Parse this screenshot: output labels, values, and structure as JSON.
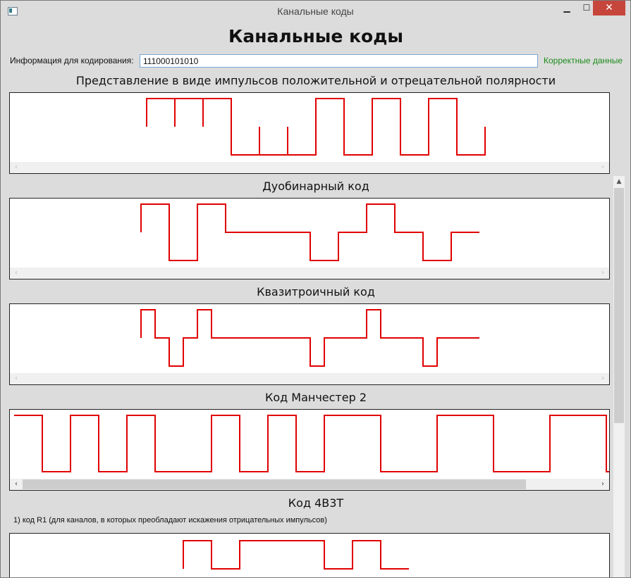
{
  "window": {
    "title": "Канальные коды"
  },
  "header": {
    "title": "Канальные коды",
    "input_label": "Информация для кодирования:",
    "input_value": "111000101010",
    "status": "Корректные данные",
    "status_color": "#1a8a1a"
  },
  "signal_color": "#e00000",
  "sections": {
    "polar": {
      "title": "Представление в виде импульсов положительной и отрецательной полярности"
    },
    "duobinary": {
      "title": "Дуобинарный код"
    },
    "quasi": {
      "title": "Квазитроичный код"
    },
    "manchester": {
      "title": "Код Манчестер 2"
    },
    "c4b3t": {
      "title": "Код 4B3T",
      "description": "1) код R1 (для каналов, в которых преобладают искажения отрицательных импульсов)"
    }
  },
  "icons": {
    "minimize": "minimize-icon",
    "maximize": "maximize-icon",
    "close": "close-icon"
  }
}
